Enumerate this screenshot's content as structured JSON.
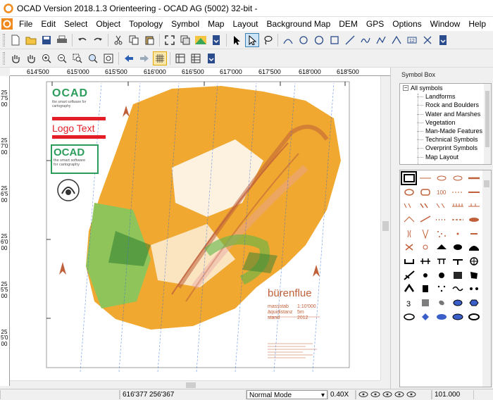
{
  "window": {
    "title": "OCAD Version 2018.1.3  Orienteering - OCAD AG (5002) 32-bit -"
  },
  "menu": {
    "items": [
      "File",
      "Edit",
      "Select",
      "Object",
      "Topology",
      "Symbol",
      "Map",
      "Layout",
      "Background Map",
      "DEM",
      "GPS",
      "Options",
      "Window",
      "Help"
    ]
  },
  "ruler": {
    "x_labels": [
      "614'500",
      "615'000",
      "615'500",
      "616'000",
      "616'500",
      "617'000",
      "617'500",
      "618'000",
      "618'500"
    ],
    "y_labels": [
      "257'500",
      "257'000",
      "256'500",
      "256'000",
      "255'500",
      "255'000"
    ]
  },
  "map": {
    "ocad_logo_top": "OCAD",
    "ocad_tagline_top": "the smart software for cartography",
    "logo_text": "Logo Text",
    "ocad_logo_box": "OCAD",
    "ocad_tagline_box_1": "the smart software",
    "ocad_tagline_box_2": "for cartography",
    "map_name": "bürenflue",
    "legend_scale_label": "massstab",
    "legend_scale_value": "1:10'000",
    "legend_equidistance_label": "äquidistanz",
    "legend_equidistance_value": "5m",
    "legend_date_label": "stand",
    "legend_date_value": "2012"
  },
  "symbol_box": {
    "header": "Symbol Box",
    "root": "All symbols",
    "categories": [
      "Landforms",
      "Rock and Boulders",
      "Water and Marshes",
      "Vegetation",
      "Man-Made Features",
      "Technical Symbols",
      "Overprint Symbols",
      "Map Layout"
    ]
  },
  "status": {
    "coordinates": "616'377  256'367",
    "mode": "Normal Mode",
    "zoom": "0.40X",
    "value": "101.000"
  },
  "colors": {
    "map_orange": "#f0a830",
    "map_green": "#5fb548",
    "map_brown": "#c0603a",
    "accent_red": "#e41e26",
    "selection_blue": "#cce4f7"
  }
}
